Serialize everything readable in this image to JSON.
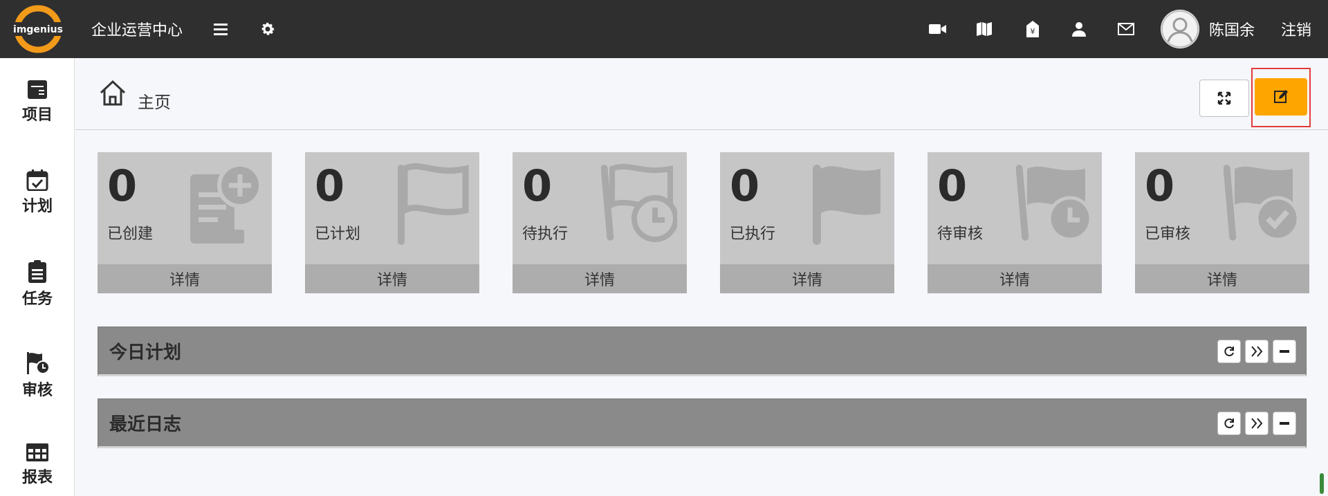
{
  "app": {
    "logo_text": "imgenius",
    "title": "企业运营中心"
  },
  "topbar": {
    "icons": [
      "video-icon",
      "map-icon",
      "price-tag-icon",
      "user-icon",
      "mail-icon"
    ],
    "username": "陈国余",
    "logout_label": "注销"
  },
  "sidebar": {
    "items": [
      {
        "label": "项目",
        "icon": "project-box-icon"
      },
      {
        "label": "计划",
        "icon": "calendar-check-icon"
      },
      {
        "label": "任务",
        "icon": "clipboard-icon"
      },
      {
        "label": "审核",
        "icon": "flag-clock-icon"
      },
      {
        "label": "报表",
        "icon": "table-grid-icon"
      }
    ]
  },
  "header": {
    "page_title": "主页"
  },
  "cards": [
    {
      "value": "0",
      "label": "已创建",
      "detail": "详情",
      "icon": "document-plus-icon"
    },
    {
      "value": "0",
      "label": "已计划",
      "detail": "详情",
      "icon": "flag-outline-icon"
    },
    {
      "value": "0",
      "label": "待执行",
      "detail": "详情",
      "icon": "flag-clock-outline-icon"
    },
    {
      "value": "0",
      "label": "已执行",
      "detail": "详情",
      "icon": "flag-solid-icon"
    },
    {
      "value": "0",
      "label": "待审核",
      "detail": "详情",
      "icon": "flag-clock-solid-icon"
    },
    {
      "value": "0",
      "label": "已审核",
      "detail": "详情",
      "icon": "flag-check-icon"
    }
  ],
  "panels": [
    {
      "title": "今日计划"
    },
    {
      "title": "最近日志"
    }
  ],
  "colors": {
    "topbar": "#2f2f2f",
    "accent": "#ffa500",
    "highlight_border": "#e23b3b",
    "card_bg": "#c6c6c6",
    "panel_bg": "#8a8a8a"
  }
}
